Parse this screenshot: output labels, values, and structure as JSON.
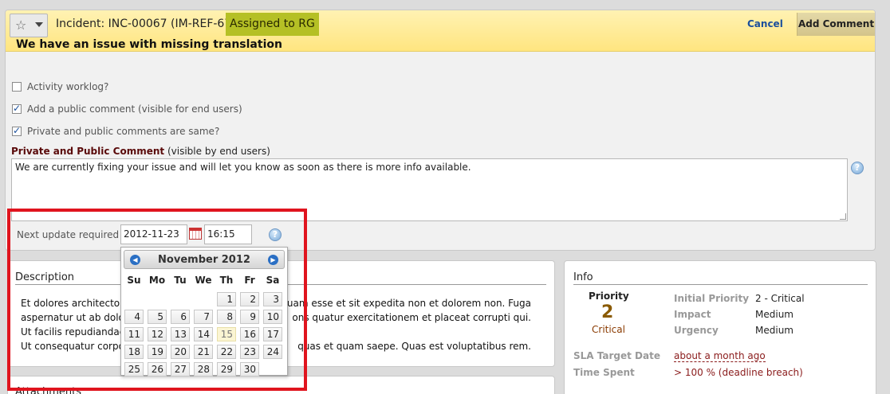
{
  "header": {
    "incident_title": "Incident: INC-00067 (IM-REF-67)",
    "assigned": "Assigned to RG",
    "subject": "We have an issue with missing translation",
    "cancel": "Cancel",
    "add_comment": "Add Comment"
  },
  "form": {
    "activity_worklog": "Activity worklog?",
    "add_public_comment": "Add a public comment (visible for end users)",
    "private_public_same": "Private and public comments are same?",
    "comment_label_bold": "Private and Public Comment",
    "comment_label_suffix": "(visible by end users)",
    "comment_text": "We are currently fixing your issue and will let you know as soon as there is more info available.",
    "checkboxes": {
      "activity_worklog": false,
      "add_public_comment": true,
      "private_public_same": true
    },
    "next_update_label": "Next update required",
    "date_value": "2012-11-23",
    "time_value": "16:15",
    "help": "?"
  },
  "calendar": {
    "month_title": "November 2012",
    "weekdays": [
      "Su",
      "Mo",
      "Tu",
      "We",
      "Th",
      "Fr",
      "Sa"
    ],
    "today": 15,
    "days": [
      1,
      2,
      3,
      4,
      5,
      6,
      7,
      8,
      9,
      10,
      11,
      12,
      13,
      14,
      15,
      16,
      17,
      18,
      19,
      20,
      21,
      22,
      23,
      24,
      25,
      26,
      27,
      28,
      29,
      30
    ],
    "first_weekday_index": 4
  },
  "description": {
    "title": "Description",
    "lines": [
      "Et dolores architecto co",
      "aspernatur ut ab dolore",
      "Ut facilis repudiandae q",
      "Ut consequatur corpori"
    ],
    "lines_right": [
      "quam esse et sit expedita non et dolorem non. Fuga",
      "ons quatur exercitationem et placeat corrupti qui.",
      "",
      "quas et quam saepe. Quas est voluptatibus rem."
    ]
  },
  "attachments": {
    "title": "Attachments"
  },
  "info": {
    "title": "Info",
    "priority_label": "Priority",
    "priority_value": "2",
    "priority_text": "Critical",
    "initial_priority_label": "Initial Priority",
    "initial_priority_value": "2 - Critical",
    "impact_label": "Impact",
    "impact_value": "Medium",
    "urgency_label": "Urgency",
    "urgency_value": "Medium",
    "sla_label": "SLA Target Date",
    "sla_value": "about a month ago",
    "time_spent_label": "Time Spent",
    "time_spent_value": "> 100 % (deadline breach)"
  },
  "colors": {
    "highlight": "#e0141e",
    "assigned_bg": "#b5c025",
    "header_bg": "#ffe580",
    "link": "#1a4f9c"
  }
}
